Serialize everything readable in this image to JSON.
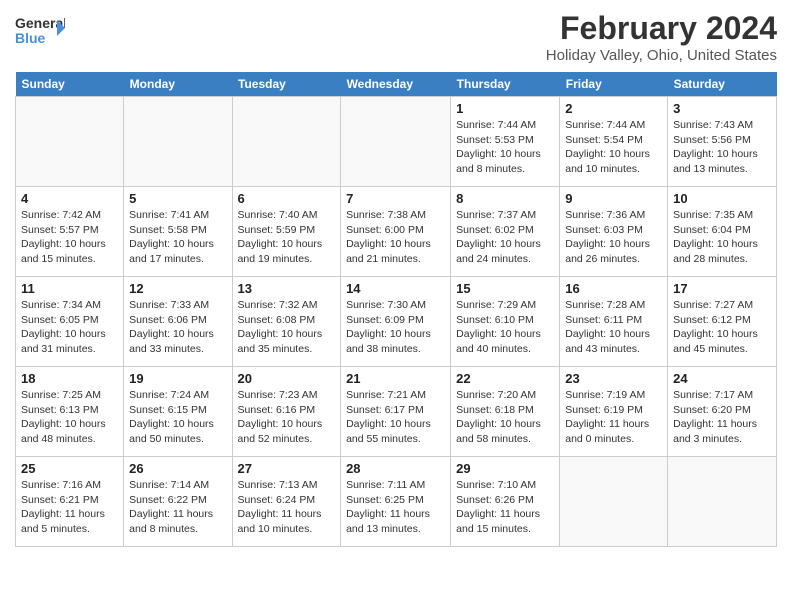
{
  "header": {
    "logo_line1": "General",
    "logo_line2": "Blue",
    "month": "February 2024",
    "location": "Holiday Valley, Ohio, United States"
  },
  "weekdays": [
    "Sunday",
    "Monday",
    "Tuesday",
    "Wednesday",
    "Thursday",
    "Friday",
    "Saturday"
  ],
  "weeks": [
    [
      {
        "day": "",
        "info": ""
      },
      {
        "day": "",
        "info": ""
      },
      {
        "day": "",
        "info": ""
      },
      {
        "day": "",
        "info": ""
      },
      {
        "day": "1",
        "info": "Sunrise: 7:44 AM\nSunset: 5:53 PM\nDaylight: 10 hours\nand 8 minutes."
      },
      {
        "day": "2",
        "info": "Sunrise: 7:44 AM\nSunset: 5:54 PM\nDaylight: 10 hours\nand 10 minutes."
      },
      {
        "day": "3",
        "info": "Sunrise: 7:43 AM\nSunset: 5:56 PM\nDaylight: 10 hours\nand 13 minutes."
      }
    ],
    [
      {
        "day": "4",
        "info": "Sunrise: 7:42 AM\nSunset: 5:57 PM\nDaylight: 10 hours\nand 15 minutes."
      },
      {
        "day": "5",
        "info": "Sunrise: 7:41 AM\nSunset: 5:58 PM\nDaylight: 10 hours\nand 17 minutes."
      },
      {
        "day": "6",
        "info": "Sunrise: 7:40 AM\nSunset: 5:59 PM\nDaylight: 10 hours\nand 19 minutes."
      },
      {
        "day": "7",
        "info": "Sunrise: 7:38 AM\nSunset: 6:00 PM\nDaylight: 10 hours\nand 21 minutes."
      },
      {
        "day": "8",
        "info": "Sunrise: 7:37 AM\nSunset: 6:02 PM\nDaylight: 10 hours\nand 24 minutes."
      },
      {
        "day": "9",
        "info": "Sunrise: 7:36 AM\nSunset: 6:03 PM\nDaylight: 10 hours\nand 26 minutes."
      },
      {
        "day": "10",
        "info": "Sunrise: 7:35 AM\nSunset: 6:04 PM\nDaylight: 10 hours\nand 28 minutes."
      }
    ],
    [
      {
        "day": "11",
        "info": "Sunrise: 7:34 AM\nSunset: 6:05 PM\nDaylight: 10 hours\nand 31 minutes."
      },
      {
        "day": "12",
        "info": "Sunrise: 7:33 AM\nSunset: 6:06 PM\nDaylight: 10 hours\nand 33 minutes."
      },
      {
        "day": "13",
        "info": "Sunrise: 7:32 AM\nSunset: 6:08 PM\nDaylight: 10 hours\nand 35 minutes."
      },
      {
        "day": "14",
        "info": "Sunrise: 7:30 AM\nSunset: 6:09 PM\nDaylight: 10 hours\nand 38 minutes."
      },
      {
        "day": "15",
        "info": "Sunrise: 7:29 AM\nSunset: 6:10 PM\nDaylight: 10 hours\nand 40 minutes."
      },
      {
        "day": "16",
        "info": "Sunrise: 7:28 AM\nSunset: 6:11 PM\nDaylight: 10 hours\nand 43 minutes."
      },
      {
        "day": "17",
        "info": "Sunrise: 7:27 AM\nSunset: 6:12 PM\nDaylight: 10 hours\nand 45 minutes."
      }
    ],
    [
      {
        "day": "18",
        "info": "Sunrise: 7:25 AM\nSunset: 6:13 PM\nDaylight: 10 hours\nand 48 minutes."
      },
      {
        "day": "19",
        "info": "Sunrise: 7:24 AM\nSunset: 6:15 PM\nDaylight: 10 hours\nand 50 minutes."
      },
      {
        "day": "20",
        "info": "Sunrise: 7:23 AM\nSunset: 6:16 PM\nDaylight: 10 hours\nand 52 minutes."
      },
      {
        "day": "21",
        "info": "Sunrise: 7:21 AM\nSunset: 6:17 PM\nDaylight: 10 hours\nand 55 minutes."
      },
      {
        "day": "22",
        "info": "Sunrise: 7:20 AM\nSunset: 6:18 PM\nDaylight: 10 hours\nand 58 minutes."
      },
      {
        "day": "23",
        "info": "Sunrise: 7:19 AM\nSunset: 6:19 PM\nDaylight: 11 hours\nand 0 minutes."
      },
      {
        "day": "24",
        "info": "Sunrise: 7:17 AM\nSunset: 6:20 PM\nDaylight: 11 hours\nand 3 minutes."
      }
    ],
    [
      {
        "day": "25",
        "info": "Sunrise: 7:16 AM\nSunset: 6:21 PM\nDaylight: 11 hours\nand 5 minutes."
      },
      {
        "day": "26",
        "info": "Sunrise: 7:14 AM\nSunset: 6:22 PM\nDaylight: 11 hours\nand 8 minutes."
      },
      {
        "day": "27",
        "info": "Sunrise: 7:13 AM\nSunset: 6:24 PM\nDaylight: 11 hours\nand 10 minutes."
      },
      {
        "day": "28",
        "info": "Sunrise: 7:11 AM\nSunset: 6:25 PM\nDaylight: 11 hours\nand 13 minutes."
      },
      {
        "day": "29",
        "info": "Sunrise: 7:10 AM\nSunset: 6:26 PM\nDaylight: 11 hours\nand 15 minutes."
      },
      {
        "day": "",
        "info": ""
      },
      {
        "day": "",
        "info": ""
      }
    ]
  ]
}
